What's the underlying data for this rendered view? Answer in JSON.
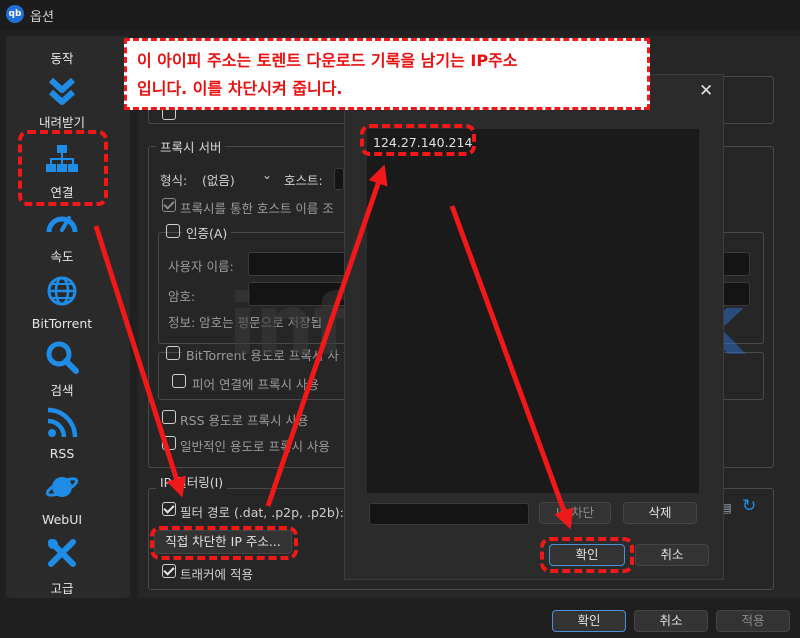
{
  "window": {
    "title": "옵션",
    "app_icon_text": "qb"
  },
  "sidebar": {
    "items": [
      {
        "label": "동작",
        "icon": "gear-icon"
      },
      {
        "label": "내려받기",
        "icon": "double-chevron-down-icon"
      },
      {
        "label": "연결",
        "icon": "network-icon"
      },
      {
        "label": "속도",
        "icon": "speedometer-icon"
      },
      {
        "label": "BitTorrent",
        "icon": "globe-icon"
      },
      {
        "label": "검색",
        "icon": "search-icon"
      },
      {
        "label": "RSS",
        "icon": "rss-icon"
      },
      {
        "label": "WebUI",
        "icon": "planet-icon"
      },
      {
        "label": "고급",
        "icon": "tools-icon"
      }
    ]
  },
  "proxy": {
    "title": "프록시 서버",
    "type_label": "형식:",
    "type_value": "(없음)",
    "host_label": "호스트:",
    "hostname_lookup": "프록시를 통한 호스트 이름 조",
    "auth_title": "인증(A)",
    "username_label": "사용자 이름:",
    "password_label": "암호:",
    "info_text": "정보: 암호는 평문으로 저장됩",
    "bittorrent_proxy": "BitTorrent 용도로 프록시 사",
    "peer_proxy": "피어 연결에 프록시 사용",
    "rss_proxy": "RSS 용도로 프록시 사용",
    "general_proxy": "일반적인 용도로 프록시 사용"
  },
  "ip_filter": {
    "title": "IP 필터링(I)",
    "filter_path_label": "필터 경로 (.dat, .p2p, .p2b):",
    "manual_banned_button": "직접 차단한 IP 주소...",
    "apply_trackers": "트래커에 적용"
  },
  "dialog": {
    "ip_list": [
      "124.27.140.214"
    ],
    "ban_button": "IP 차단",
    "delete_button": "삭제",
    "ok_button": "확인",
    "cancel_button": "취소"
  },
  "footer": {
    "ok": "확인",
    "cancel": "취소",
    "apply": "적용"
  },
  "annotation": {
    "line1": "이 아이피 주소는 토렌트 다운로드 기록을 남기는 IP주소",
    "line2": "입니다. 이를 차단시켜 줍니다."
  },
  "watermark": {
    "part1": "inform",
    "part2": "hack"
  },
  "colors": {
    "accent": "#1f8ce6",
    "annotation_red": "#f01818",
    "dark_bg": "#202020"
  }
}
